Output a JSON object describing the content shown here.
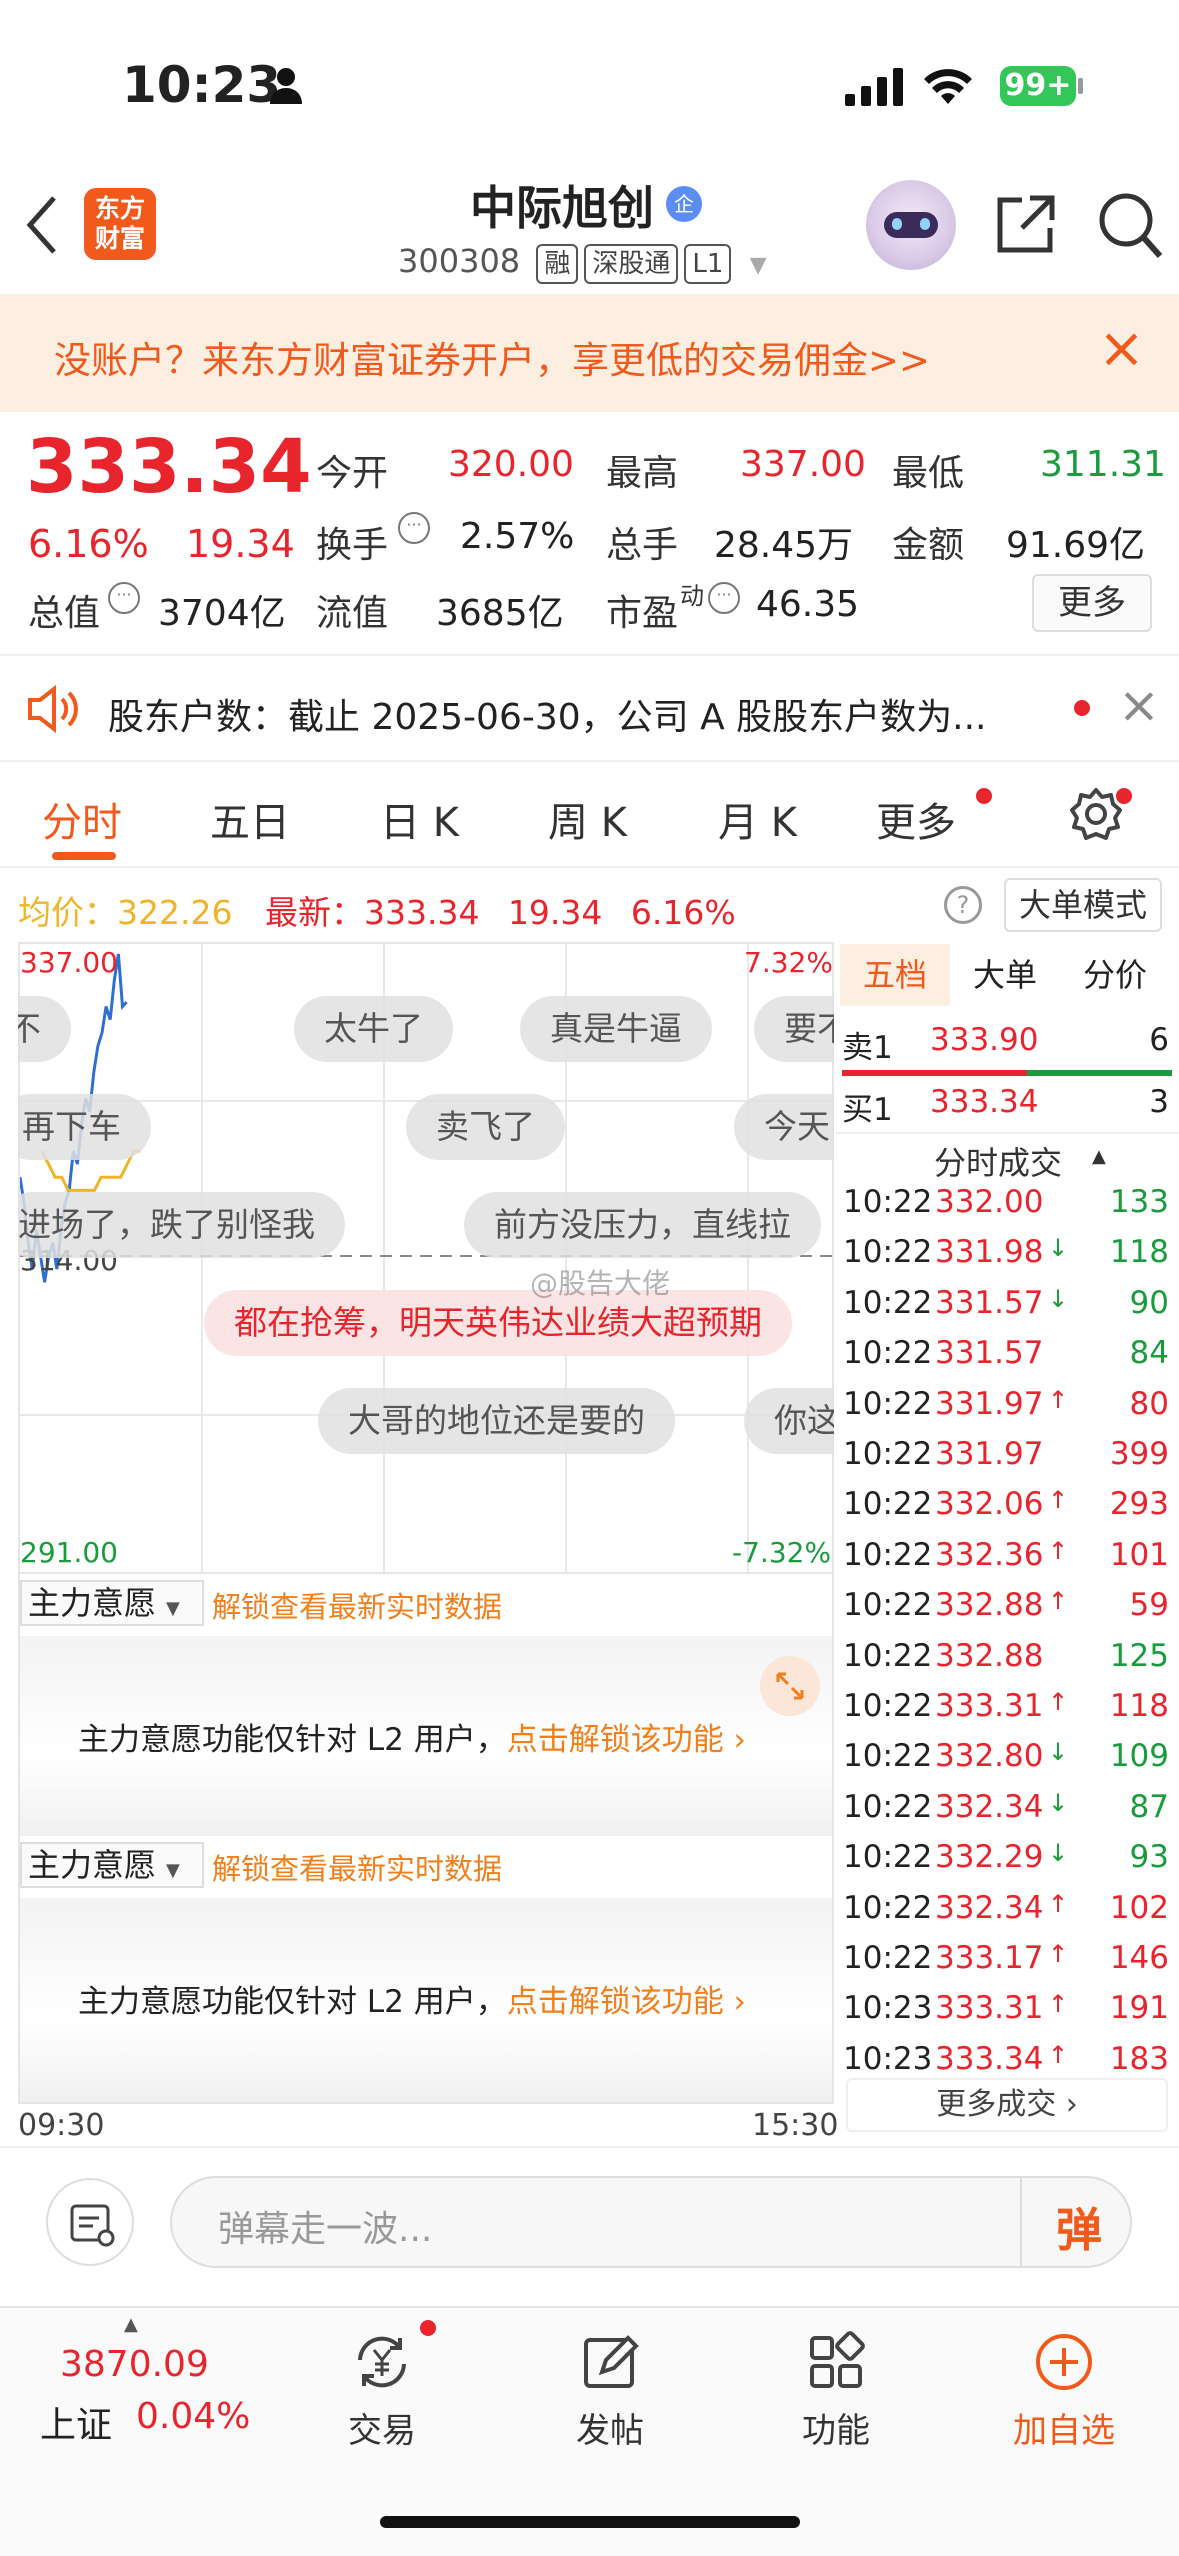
{
  "status": {
    "time": "10:23",
    "battery": "99+"
  },
  "header": {
    "back": "‹",
    "logo": "东方\n财富",
    "logo1": "东方",
    "logo2": "财富",
    "title": "中际旭创",
    "title_badge": "企",
    "code": "300308",
    "tags": [
      "融",
      "深股通",
      "L1"
    ]
  },
  "banner": {
    "text": "没账户？来东方财富证券开户，享更低的交易佣金>>",
    "close": "×"
  },
  "quote": {
    "price": "333.34",
    "change_pct": "6.16%",
    "change": "19.34",
    "open_l": "今开",
    "open": "320.00",
    "high_l": "最高",
    "high": "337.00",
    "low_l": "最低",
    "low": "311.31",
    "turnover_l": "换手",
    "turnover": "2.57%",
    "vol_l": "总手",
    "vol": "28.45万",
    "amt_l": "金额",
    "amt": "91.69亿",
    "mcap_l": "总值",
    "mcap": "3704亿",
    "float_l": "流值",
    "float": "3685亿",
    "pe_l": "市盈",
    "pe_sup": "动",
    "pe": "46.35",
    "more": "更多"
  },
  "notice": {
    "text": "股东户数：截止 2025-06-30，公司 A 股股东户数为...",
    "close": "×"
  },
  "tabs": [
    "分时",
    "五日",
    "日 K",
    "周 K",
    "月 K",
    "更多"
  ],
  "info": {
    "avg_l": "均价：",
    "avg": "322.26",
    "new_l": "最新：",
    "new": "333.34",
    "chg": "19.34",
    "pct": "6.16%",
    "help": "?",
    "mode": "大单模式"
  },
  "chart_data": {
    "type": "line",
    "y_top": "337.00",
    "y_bottom": "291.00",
    "y_mid": "314.00",
    "pct_top": "7.32%",
    "pct_bottom": "-7.32%",
    "x_start": "09:30",
    "x_end": "15:30",
    "ylim": [
      291,
      337
    ],
    "series": [
      {
        "values": [
          320,
          318,
          315,
          313,
          316,
          314,
          312,
          314,
          315,
          313,
          316,
          318,
          319,
          322,
          321,
          324,
          326,
          325,
          328,
          330,
          331,
          333,
          332,
          335,
          337,
          333,
          333.34
        ]
      },
      {
        "values": [
          322,
          321,
          320,
          320,
          319,
          319,
          319,
          319,
          319,
          320,
          320,
          320,
          320,
          321,
          322,
          322
        ]
      }
    ]
  },
  "danmu": [
    "太牛了",
    "真是牛逼",
    "要不",
    "再下车",
    "卖飞了",
    "今天",
    "进场了，跌了别怪我",
    "前方没压力，直线拉",
    "都在抢筹，明天英伟达业绩大超预期",
    "大哥的地位还是要的",
    "你这",
    "不"
  ],
  "watermark": "@股告大佬",
  "panel1": {
    "dropdown": "主力意愿",
    "link": "解锁查看最新实时数据",
    "msg": "主力意愿功能仅针对 L2 用户，",
    "cta": "点击解锁该功能"
  },
  "panel2": {
    "dropdown": "主力意愿",
    "link": "解锁查看最新实时数据",
    "msg": "主力意愿功能仅针对 L2 用户，",
    "cta": "点击解锁该功能"
  },
  "side_tabs": [
    "五档",
    "大单",
    "分价"
  ],
  "orderbook": {
    "sell_l": "卖1",
    "sell_p": "333.90",
    "sell_v": "6",
    "buy_l": "买1",
    "buy_p": "333.34",
    "buy_v": "3"
  },
  "trades_title": "分时成交",
  "trades": [
    {
      "t": "10:22",
      "p": "332.00",
      "a": "",
      "v": "133",
      "pc": "red",
      "vc": "green"
    },
    {
      "t": "10:22",
      "p": "331.98",
      "a": "↓",
      "v": "118",
      "pc": "red",
      "vc": "green"
    },
    {
      "t": "10:22",
      "p": "331.57",
      "a": "↓",
      "v": "90",
      "pc": "red",
      "vc": "green"
    },
    {
      "t": "10:22",
      "p": "331.57",
      "a": "",
      "v": "84",
      "pc": "red",
      "vc": "green"
    },
    {
      "t": "10:22",
      "p": "331.97",
      "a": "↑",
      "v": "80",
      "pc": "red",
      "vc": "red"
    },
    {
      "t": "10:22",
      "p": "331.97",
      "a": "",
      "v": "399",
      "pc": "red",
      "vc": "red"
    },
    {
      "t": "10:22",
      "p": "332.06",
      "a": "↑",
      "v": "293",
      "pc": "red",
      "vc": "red"
    },
    {
      "t": "10:22",
      "p": "332.36",
      "a": "↑",
      "v": "101",
      "pc": "red",
      "vc": "red"
    },
    {
      "t": "10:22",
      "p": "332.88",
      "a": "↑",
      "v": "59",
      "pc": "red",
      "vc": "red"
    },
    {
      "t": "10:22",
      "p": "332.88",
      "a": "",
      "v": "125",
      "pc": "red",
      "vc": "green"
    },
    {
      "t": "10:22",
      "p": "333.31",
      "a": "↑",
      "v": "118",
      "pc": "red",
      "vc": "red"
    },
    {
      "t": "10:22",
      "p": "332.80",
      "a": "↓",
      "v": "109",
      "pc": "red",
      "vc": "green"
    },
    {
      "t": "10:22",
      "p": "332.34",
      "a": "↓",
      "v": "87",
      "pc": "red",
      "vc": "green"
    },
    {
      "t": "10:22",
      "p": "332.29",
      "a": "↓",
      "v": "93",
      "pc": "red",
      "vc": "green"
    },
    {
      "t": "10:22",
      "p": "332.34",
      "a": "↑",
      "v": "102",
      "pc": "red",
      "vc": "red"
    },
    {
      "t": "10:22",
      "p": "333.17",
      "a": "↑",
      "v": "146",
      "pc": "red",
      "vc": "red"
    },
    {
      "t": "10:23",
      "p": "333.31",
      "a": "↑",
      "v": "191",
      "pc": "red",
      "vc": "red"
    },
    {
      "t": "10:23",
      "p": "333.34",
      "a": "↑",
      "v": "183",
      "pc": "red",
      "vc": "red"
    }
  ],
  "more_trades": "更多成交 ›",
  "comment": {
    "placeholder": "弹幕走一波...",
    "btn": "弹"
  },
  "bottom": {
    "index_val": "3870.09",
    "index_name": "上证",
    "index_pct": "0.04%",
    "items": [
      "交易",
      "发帖",
      "功能",
      "加自选"
    ]
  }
}
